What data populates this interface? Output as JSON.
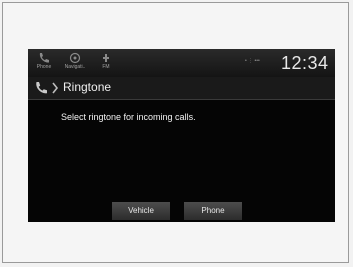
{
  "statusbar": {
    "items": [
      {
        "label": "Phone",
        "icon": "phone-icon"
      },
      {
        "label": "Navigati..",
        "icon": "navigation-icon"
      },
      {
        "label": "FM",
        "icon": "radio-icon"
      }
    ],
    "signal_text": "• ⋮ •••",
    "clock": "12:34"
  },
  "header": {
    "title": "Ringtone"
  },
  "main": {
    "message": "Select ringtone for incoming calls."
  },
  "buttons": {
    "vehicle": "Vehicle",
    "phone": "Phone"
  }
}
